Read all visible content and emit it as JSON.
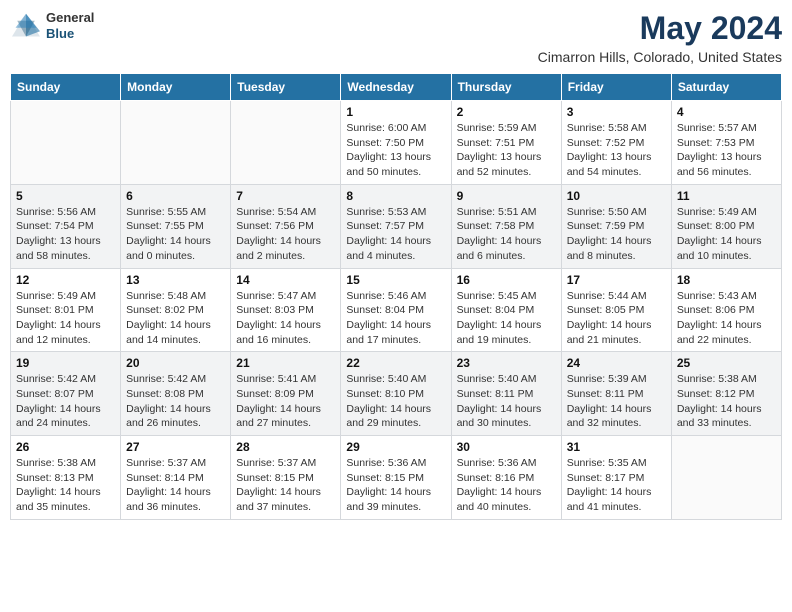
{
  "header": {
    "logo_line1": "General",
    "logo_line2": "Blue",
    "month_title": "May 2024",
    "location": "Cimarron Hills, Colorado, United States"
  },
  "days_of_week": [
    "Sunday",
    "Monday",
    "Tuesday",
    "Wednesday",
    "Thursday",
    "Friday",
    "Saturday"
  ],
  "weeks": [
    [
      {
        "day": "",
        "info": ""
      },
      {
        "day": "",
        "info": ""
      },
      {
        "day": "",
        "info": ""
      },
      {
        "day": "1",
        "info": "Sunrise: 6:00 AM\nSunset: 7:50 PM\nDaylight: 13 hours\nand 50 minutes."
      },
      {
        "day": "2",
        "info": "Sunrise: 5:59 AM\nSunset: 7:51 PM\nDaylight: 13 hours\nand 52 minutes."
      },
      {
        "day": "3",
        "info": "Sunrise: 5:58 AM\nSunset: 7:52 PM\nDaylight: 13 hours\nand 54 minutes."
      },
      {
        "day": "4",
        "info": "Sunrise: 5:57 AM\nSunset: 7:53 PM\nDaylight: 13 hours\nand 56 minutes."
      }
    ],
    [
      {
        "day": "5",
        "info": "Sunrise: 5:56 AM\nSunset: 7:54 PM\nDaylight: 13 hours\nand 58 minutes."
      },
      {
        "day": "6",
        "info": "Sunrise: 5:55 AM\nSunset: 7:55 PM\nDaylight: 14 hours\nand 0 minutes."
      },
      {
        "day": "7",
        "info": "Sunrise: 5:54 AM\nSunset: 7:56 PM\nDaylight: 14 hours\nand 2 minutes."
      },
      {
        "day": "8",
        "info": "Sunrise: 5:53 AM\nSunset: 7:57 PM\nDaylight: 14 hours\nand 4 minutes."
      },
      {
        "day": "9",
        "info": "Sunrise: 5:51 AM\nSunset: 7:58 PM\nDaylight: 14 hours\nand 6 minutes."
      },
      {
        "day": "10",
        "info": "Sunrise: 5:50 AM\nSunset: 7:59 PM\nDaylight: 14 hours\nand 8 minutes."
      },
      {
        "day": "11",
        "info": "Sunrise: 5:49 AM\nSunset: 8:00 PM\nDaylight: 14 hours\nand 10 minutes."
      }
    ],
    [
      {
        "day": "12",
        "info": "Sunrise: 5:49 AM\nSunset: 8:01 PM\nDaylight: 14 hours\nand 12 minutes."
      },
      {
        "day": "13",
        "info": "Sunrise: 5:48 AM\nSunset: 8:02 PM\nDaylight: 14 hours\nand 14 minutes."
      },
      {
        "day": "14",
        "info": "Sunrise: 5:47 AM\nSunset: 8:03 PM\nDaylight: 14 hours\nand 16 minutes."
      },
      {
        "day": "15",
        "info": "Sunrise: 5:46 AM\nSunset: 8:04 PM\nDaylight: 14 hours\nand 17 minutes."
      },
      {
        "day": "16",
        "info": "Sunrise: 5:45 AM\nSunset: 8:04 PM\nDaylight: 14 hours\nand 19 minutes."
      },
      {
        "day": "17",
        "info": "Sunrise: 5:44 AM\nSunset: 8:05 PM\nDaylight: 14 hours\nand 21 minutes."
      },
      {
        "day": "18",
        "info": "Sunrise: 5:43 AM\nSunset: 8:06 PM\nDaylight: 14 hours\nand 22 minutes."
      }
    ],
    [
      {
        "day": "19",
        "info": "Sunrise: 5:42 AM\nSunset: 8:07 PM\nDaylight: 14 hours\nand 24 minutes."
      },
      {
        "day": "20",
        "info": "Sunrise: 5:42 AM\nSunset: 8:08 PM\nDaylight: 14 hours\nand 26 minutes."
      },
      {
        "day": "21",
        "info": "Sunrise: 5:41 AM\nSunset: 8:09 PM\nDaylight: 14 hours\nand 27 minutes."
      },
      {
        "day": "22",
        "info": "Sunrise: 5:40 AM\nSunset: 8:10 PM\nDaylight: 14 hours\nand 29 minutes."
      },
      {
        "day": "23",
        "info": "Sunrise: 5:40 AM\nSunset: 8:11 PM\nDaylight: 14 hours\nand 30 minutes."
      },
      {
        "day": "24",
        "info": "Sunrise: 5:39 AM\nSunset: 8:11 PM\nDaylight: 14 hours\nand 32 minutes."
      },
      {
        "day": "25",
        "info": "Sunrise: 5:38 AM\nSunset: 8:12 PM\nDaylight: 14 hours\nand 33 minutes."
      }
    ],
    [
      {
        "day": "26",
        "info": "Sunrise: 5:38 AM\nSunset: 8:13 PM\nDaylight: 14 hours\nand 35 minutes."
      },
      {
        "day": "27",
        "info": "Sunrise: 5:37 AM\nSunset: 8:14 PM\nDaylight: 14 hours\nand 36 minutes."
      },
      {
        "day": "28",
        "info": "Sunrise: 5:37 AM\nSunset: 8:15 PM\nDaylight: 14 hours\nand 37 minutes."
      },
      {
        "day": "29",
        "info": "Sunrise: 5:36 AM\nSunset: 8:15 PM\nDaylight: 14 hours\nand 39 minutes."
      },
      {
        "day": "30",
        "info": "Sunrise: 5:36 AM\nSunset: 8:16 PM\nDaylight: 14 hours\nand 40 minutes."
      },
      {
        "day": "31",
        "info": "Sunrise: 5:35 AM\nSunset: 8:17 PM\nDaylight: 14 hours\nand 41 minutes."
      },
      {
        "day": "",
        "info": ""
      }
    ]
  ]
}
